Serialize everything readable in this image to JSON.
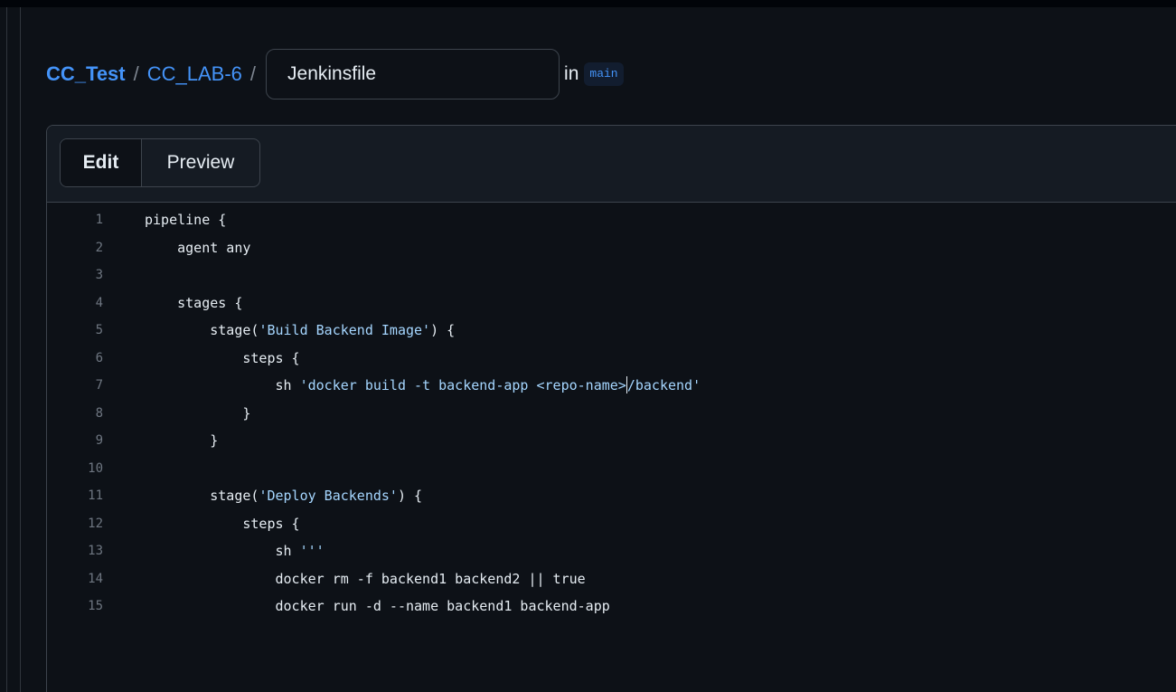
{
  "breadcrumb": {
    "owner": "CC_Test",
    "separator": "/",
    "repo": "CC_LAB-6",
    "filename_value": "Jenkinsfile",
    "in_label": "in",
    "branch": "main"
  },
  "editor": {
    "tabs": {
      "edit": "Edit",
      "preview": "Preview"
    },
    "active_tab": "Edit",
    "lines": [
      {
        "num": "1",
        "text": "pipeline {"
      },
      {
        "num": "2",
        "text": "    agent any"
      },
      {
        "num": "3",
        "text": ""
      },
      {
        "num": "4",
        "text": "    stages {"
      },
      {
        "num": "5",
        "text": "        stage(",
        "str": "'Build Backend Image'",
        "tail": ") {"
      },
      {
        "num": "6",
        "text": "            steps {"
      },
      {
        "num": "7",
        "text": "                sh ",
        "str": "'docker build -t backend-app <repo-name>",
        "caret": true,
        "str2": "/backend'"
      },
      {
        "num": "8",
        "text": "            }"
      },
      {
        "num": "9",
        "text": "        }"
      },
      {
        "num": "10",
        "text": ""
      },
      {
        "num": "11",
        "text": "        stage(",
        "str": "'Deploy Backends'",
        "tail": ") {"
      },
      {
        "num": "12",
        "text": "            steps {"
      },
      {
        "num": "13",
        "text": "                sh ",
        "str": "'''"
      },
      {
        "num": "14",
        "text": "                docker rm -f backend1 backend2 || true"
      },
      {
        "num": "15",
        "text": "                docker run -d --name backend1 backend-app"
      }
    ]
  },
  "colors": {
    "background": "#0d1117",
    "link": "#4493f8",
    "string": "#a5d6ff",
    "line_number": "#6e7681"
  }
}
